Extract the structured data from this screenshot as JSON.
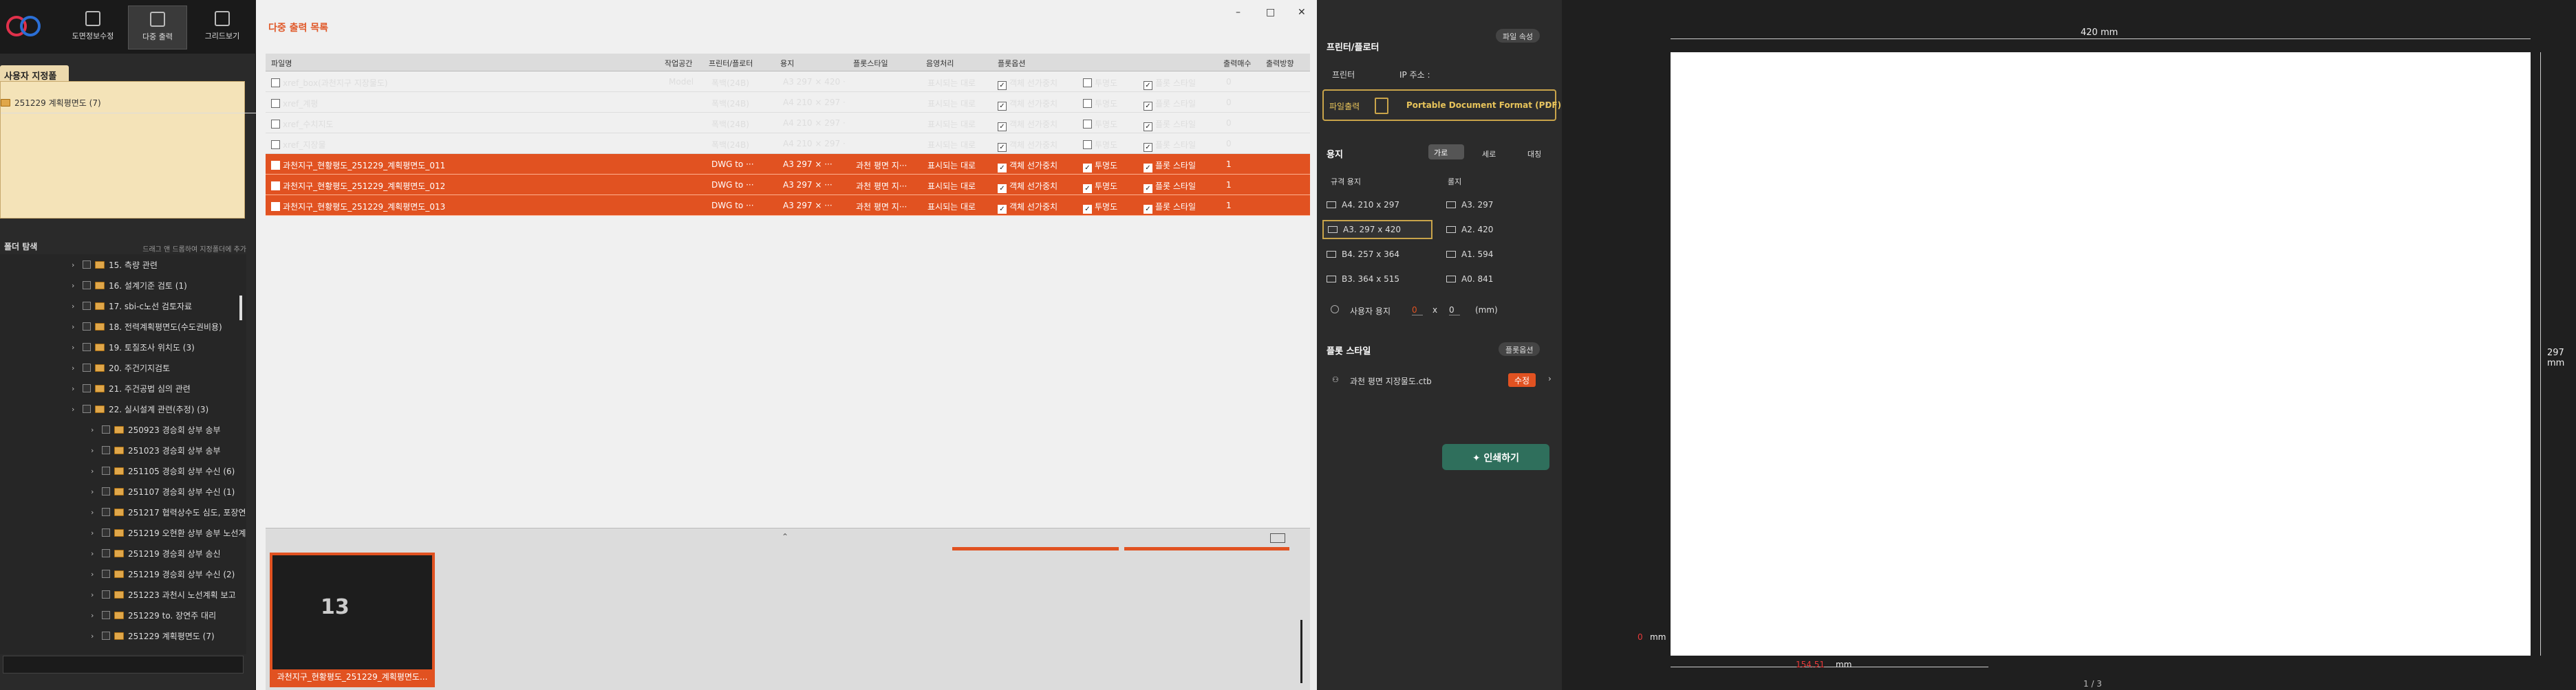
{
  "app": {
    "title": "다중 출력 목록",
    "window_controls": [
      "–",
      "□",
      "✕"
    ]
  },
  "toolbar": {
    "buttons": [
      {
        "label": "도면정보수정"
      },
      {
        "label": "다중 출력"
      },
      {
        "label": "그리드보기"
      }
    ]
  },
  "left": {
    "user_folder_title": "사용자 지정폴더",
    "user_folder_item": "251229 계획평면도 (7)",
    "tree_title": "폴더 탐색",
    "tree_hint": "드래그 앤 드롭하여 지정폴더에 추가",
    "tree_items": [
      "15. 측량 관련",
      "16. 설계기준 검토 (1)",
      "17. sbi-c노선 검토자료",
      "18. 전력계획평면도(수도권비용)",
      "19. 토질조사 위치도 (3)",
      "20. 주건기지검토",
      "21. 주건공법 심의 관련",
      "22. 실시설계 관련(추정) (3)",
      "250923 경승회 상부 송부",
      "251023 경승회 상부 송부",
      "251105 경승회 상부 수신 (6)",
      "251107 경승회 상부 수신 (1)",
      "251217 협력상수도 심도, 포장연",
      "251219 오현환 상부 송부 노선계",
      "251219 경승회 상부 송신",
      "251219 경승회 상부 수신 (2)",
      "251223 과천시 노선계획 보고",
      "251229 to. 장연주 대리",
      "251229 계획평면도 (7)"
    ]
  },
  "table": {
    "headers": [
      "파일명",
      "작업공간",
      "프린터/플로터",
      "용지",
      "플롯스타일",
      "음영처리",
      "플롯옵션",
      "",
      "",
      "",
      "출력매수",
      "출력방향"
    ],
    "rows": [
      {
        "name": "xref_box(과천지구 지장물도)",
        "space": "Model",
        "printer": "폭백(24B)",
        "paper": "A3 297 × 420 ···",
        "style": "",
        "shade": "표시되는 대로",
        "o1": "객체 선가중치",
        "o2": "투명도",
        "o3": "플롯 스타일",
        "copies": "0",
        "dir": "",
        "selected": false
      },
      {
        "name": "xref_계평",
        "space": "",
        "printer": "폭백(24B)",
        "paper": "A4 210 × 297 ···",
        "style": "",
        "shade": "표시되는 대로",
        "o1": "객체 선가중치",
        "o2": "투명도",
        "o3": "플롯 스타일",
        "copies": "0",
        "dir": "",
        "selected": false
      },
      {
        "name": "xref_수치지도",
        "space": "",
        "printer": "폭백(24B)",
        "paper": "A4 210 × 297 ···",
        "style": "",
        "shade": "표시되는 대로",
        "o1": "객체 선가중치",
        "o2": "투명도",
        "o3": "플롯 스타일",
        "copies": "0",
        "dir": "",
        "selected": false
      },
      {
        "name": "xref_지장물",
        "space": "",
        "printer": "폭백(24B)",
        "paper": "A4 210 × 297 ···",
        "style": "",
        "shade": "표시되는 대로",
        "o1": "객체 선가중치",
        "o2": "투명도",
        "o3": "플롯 스타일",
        "copies": "0",
        "dir": "",
        "selected": false
      },
      {
        "name": "과천지구_현황평도_251229_계획평면도_011",
        "space": "",
        "printer": "DWG to ···",
        "paper": "A3 297 × ···",
        "style": "과천 평면 지···",
        "shade": "표시되는 대로",
        "o1": "객체 선가중치",
        "o2": "투명도",
        "o3": "플롯 스타일",
        "copies": "1",
        "dir": "",
        "selected": true
      },
      {
        "name": "과천지구_현황평도_251229_계획평면도_012",
        "space": "",
        "printer": "DWG to ···",
        "paper": "A3 297 × ···",
        "style": "과천 평면 지···",
        "shade": "표시되는 대로",
        "o1": "객체 선가중치",
        "o2": "투명도",
        "o3": "플롯 스타일",
        "copies": "1",
        "dir": "",
        "selected": true
      },
      {
        "name": "과천지구_현황평도_251229_계획평면도_013",
        "space": "",
        "printer": "DWG to ···",
        "paper": "A3 297 × ···",
        "style": "과천 평면 지···",
        "shade": "표시되는 대로",
        "o1": "객체 선가중치",
        "o2": "투명도",
        "o3": "플롯 스타일",
        "copies": "1",
        "dir": "",
        "selected": true
      }
    ]
  },
  "preview": {
    "thumb_label": "과천지구_현황평도_251229_계획평면도...",
    "thumb_number": "13"
  },
  "right": {
    "file_attr": "파일 속성",
    "printer_section": "프린터/플로터",
    "printer_label": "프린터",
    "ip_label": "IP 주소 :",
    "output_label": "파일출력",
    "output_value": "Portable Document Format (PDF)",
    "paper_section": "용지",
    "orient": [
      "가로",
      "세로"
    ],
    "flip": "대칭",
    "std_paper": "규격 용지",
    "roll_paper": "롤지",
    "papers_left": [
      "A4. 210 x 297",
      "A3. 297 x 420",
      "B4. 257 x 364",
      "B3. 364 x 515"
    ],
    "papers_right": [
      "A3. 297",
      "A2. 420",
      "A1. 594",
      "A0. 841"
    ],
    "custom": "사용자 용지",
    "custom_w": "0",
    "custom_x": "x",
    "custom_h": "0",
    "custom_unit": "(mm)",
    "style_section": "플롯 스타일",
    "style_options": "플롯옵션",
    "style_file": "과천 평면 지장물도.ctb",
    "edit": "수정",
    "print": "인쇄하기"
  },
  "canvas": {
    "top_dim": "420 mm",
    "side_dim": "297 mm",
    "offset": "0",
    "offset_unit": "mm",
    "bottom_dim": "154.51",
    "bottom_unit": "mm",
    "page": "1 / 3"
  }
}
